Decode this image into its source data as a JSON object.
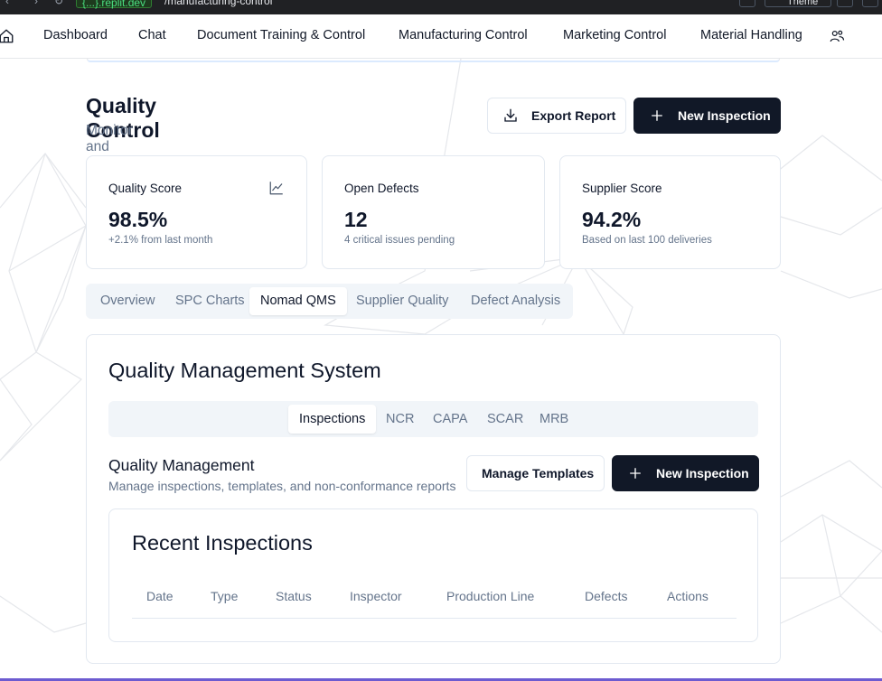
{
  "browser": {
    "url_host": "{...}.replit.dev",
    "url_path": "/manufacturing-control",
    "theme_label": "Theme"
  },
  "topnav": {
    "items": [
      {
        "label": "Dashboard"
      },
      {
        "label": "Chat"
      },
      {
        "label": "Document Training & Control"
      },
      {
        "label": "Manufacturing Control"
      },
      {
        "label": "Marketing Control"
      },
      {
        "label": "Material Handling"
      }
    ]
  },
  "header": {
    "title": "Quality Control",
    "subtitle": "Monitor and optimize production quality metrics",
    "export_label": "Export Report",
    "new_inspection_label": "New Inspection"
  },
  "stats": [
    {
      "label": "Quality Score",
      "value": "98.5%",
      "note": "+2.1% from last month",
      "icon": "trend-line-icon"
    },
    {
      "label": "Open Defects",
      "value": "12",
      "note": "4 critical issues pending"
    },
    {
      "label": "Supplier Score",
      "value": "94.2%",
      "note": "Based on last 100 deliveries"
    }
  ],
  "tabs": {
    "items": [
      {
        "label": "Overview"
      },
      {
        "label": "SPC Charts"
      },
      {
        "label": "Nomad QMS"
      },
      {
        "label": "Supplier Quality"
      },
      {
        "label": "Defect Analysis"
      }
    ],
    "active": "Nomad QMS"
  },
  "qms": {
    "title": "Quality Management System",
    "subtabs": [
      {
        "label": "Inspections"
      },
      {
        "label": "NCR"
      },
      {
        "label": "CAPA"
      },
      {
        "label": "SCAR"
      },
      {
        "label": "MRB"
      }
    ],
    "active_subtab": "Inspections",
    "section_title": "Quality Management",
    "section_desc": "Manage inspections, templates, and non-conformance reports",
    "manage_templates_label": "Manage Templates",
    "new_inspection_label": "New Inspection",
    "recent": {
      "title": "Recent Inspections",
      "columns": [
        "Date",
        "Type",
        "Status",
        "Inspector",
        "Production Line",
        "Defects",
        "Actions"
      ]
    }
  },
  "colors": {
    "primary_dark": "#111827",
    "muted_text": "#64748b",
    "border": "#e2e8f0",
    "tab_bg": "#f1f5f9"
  }
}
